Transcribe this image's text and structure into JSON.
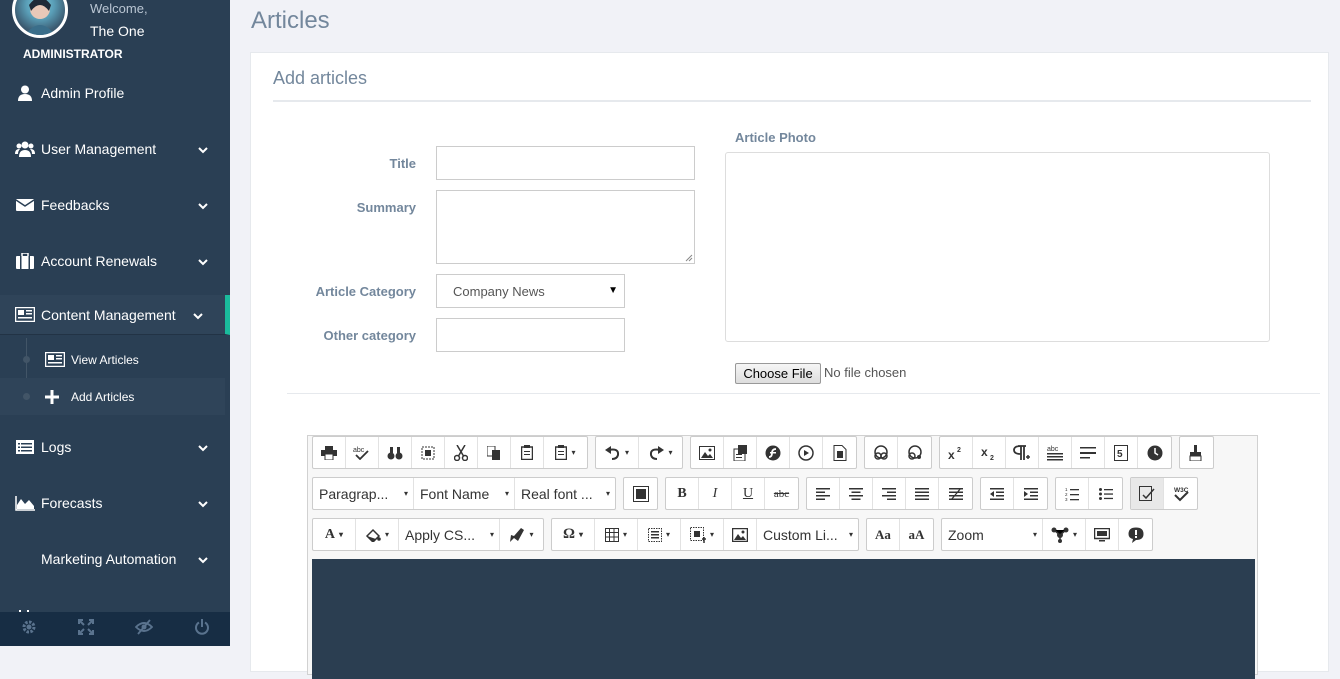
{
  "sidebar": {
    "welcome": "Welcome,",
    "username": "The One",
    "role": "ADMINISTRATOR",
    "items": [
      {
        "label": "Admin Profile",
        "icon": "user-icon"
      },
      {
        "label": "User Management",
        "icon": "users-icon"
      },
      {
        "label": "Feedbacks",
        "icon": "envelope-icon"
      },
      {
        "label": "Account Renewals",
        "icon": "briefcase-icon"
      },
      {
        "label": "Content Management",
        "icon": "newspaper-icon"
      },
      {
        "label": "Logs",
        "icon": "list-icon"
      },
      {
        "label": "Forecasts",
        "icon": "area-chart-icon"
      },
      {
        "label": "Marketing Automation",
        "icon": "bullhorn-icon"
      }
    ],
    "subitems": [
      {
        "label": "View Articles",
        "icon": "newspaper-icon"
      },
      {
        "label": "Add Articles",
        "icon": "plus-icon"
      }
    ],
    "footer_icons": [
      "settings-icon",
      "fullscreen-icon",
      "lock-icon",
      "logout-icon"
    ]
  },
  "page": {
    "title": "Articles",
    "panel_title": "Add articles"
  },
  "form": {
    "title_label": "Title",
    "summary_label": "Summary",
    "category_label": "Article Category",
    "category_value": "Company News",
    "other_label": "Other category",
    "photo_label": "Article Photo",
    "choose_file": "Choose File",
    "no_file": "No file chosen"
  },
  "editor": {
    "paragraph": "Paragrap...",
    "font_name": "Font Name",
    "font_size": "Real font ...",
    "apply_css": "Apply CS...",
    "custom_list": "Custom Li...",
    "zoom": "Zoom"
  },
  "colors": {
    "sidebar": "#2a3f54",
    "accent": "#1abb9c",
    "editor_bg": "#2b3e51"
  }
}
